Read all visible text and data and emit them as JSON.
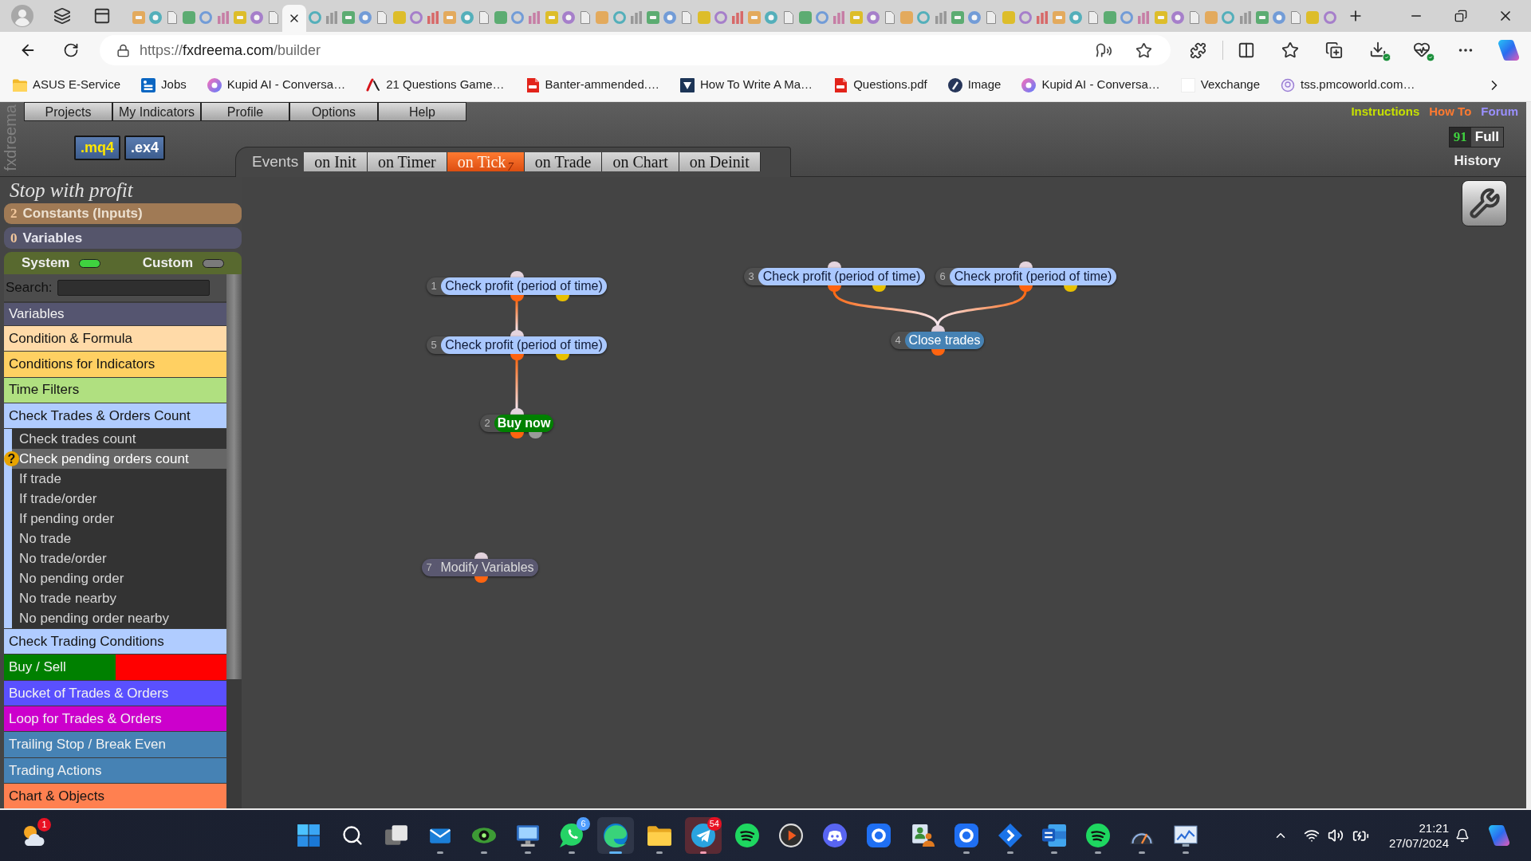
{
  "browser": {
    "tabs": [
      {
        "selected": false
      },
      {
        "selected": false
      },
      {
        "selected": false
      },
      {
        "selected": false
      },
      {
        "selected": false
      },
      {
        "selected": false
      },
      {
        "selected": false
      },
      {
        "selected": false
      },
      {
        "selected": false
      },
      {
        "selected": true
      },
      {
        "selected": false
      },
      {
        "selected": false
      },
      {
        "selected": false
      },
      {
        "selected": false
      },
      {
        "selected": false
      },
      {
        "selected": false
      },
      {
        "selected": false
      },
      {
        "selected": false
      },
      {
        "selected": false
      },
      {
        "selected": false
      },
      {
        "selected": false
      },
      {
        "selected": false
      },
      {
        "selected": false
      },
      {
        "selected": false
      },
      {
        "selected": false
      },
      {
        "selected": false
      },
      {
        "selected": false
      },
      {
        "selected": false
      },
      {
        "selected": false
      },
      {
        "selected": false
      },
      {
        "selected": false
      },
      {
        "selected": false
      },
      {
        "selected": false
      },
      {
        "selected": false
      },
      {
        "selected": false
      },
      {
        "selected": false
      },
      {
        "selected": false
      },
      {
        "selected": false
      },
      {
        "selected": false
      },
      {
        "selected": false
      },
      {
        "selected": false
      },
      {
        "selected": false
      },
      {
        "selected": false
      },
      {
        "selected": false
      },
      {
        "selected": false
      },
      {
        "selected": false
      },
      {
        "selected": false
      },
      {
        "selected": false
      },
      {
        "selected": false
      },
      {
        "selected": false
      },
      {
        "selected": false
      },
      {
        "selected": false
      },
      {
        "selected": false
      },
      {
        "selected": false
      },
      {
        "selected": false
      },
      {
        "selected": false
      },
      {
        "selected": false
      },
      {
        "selected": false
      },
      {
        "selected": false
      },
      {
        "selected": false
      },
      {
        "selected": false
      },
      {
        "selected": false
      },
      {
        "selected": false
      },
      {
        "selected": false
      },
      {
        "selected": false
      },
      {
        "selected": false
      },
      {
        "selected": false
      },
      {
        "selected": false
      },
      {
        "selected": false
      },
      {
        "selected": false
      },
      {
        "selected": false
      }
    ],
    "address": {
      "scheme": "https://",
      "domain": "fxdreema.com",
      "path": "/builder"
    },
    "bookmarks": [
      {
        "label": "ASUS E-Service",
        "kind": "folder"
      },
      {
        "label": "Jobs",
        "kind": "tile"
      },
      {
        "label": "Kupid AI - Conversa…",
        "kind": "disc"
      },
      {
        "label": "21 Questions Game…",
        "kind": "script"
      },
      {
        "label": "Banter-ammended.…",
        "kind": "pdf"
      },
      {
        "label": "How To Write A Ma…",
        "kind": "tile-dark"
      },
      {
        "label": "Questions.pdf",
        "kind": "pdf"
      },
      {
        "label": "Image",
        "kind": "disc-dark"
      },
      {
        "label": "Kupid AI - Conversa…",
        "kind": "disc"
      },
      {
        "label": "Vexchange",
        "kind": "blank"
      },
      {
        "label": "tss.pmcoworld.com…",
        "kind": "ring"
      }
    ]
  },
  "app": {
    "brand": "fxdreema",
    "menu": [
      "Projects",
      "My Indicators",
      "Profile",
      "Options",
      "Help"
    ],
    "file_buttons": [
      {
        "label": ".mq4",
        "color": "#ffe600"
      },
      {
        "label": ".ex4",
        "color": "#ffffff"
      }
    ],
    "events": {
      "label": "Events",
      "tabs": [
        {
          "label": "on Init",
          "selected": false
        },
        {
          "label": "on Timer",
          "selected": false
        },
        {
          "label": "on Tick",
          "count": "7",
          "selected": true
        },
        {
          "label": "on Trade",
          "selected": false
        },
        {
          "label": "on Chart",
          "selected": false
        },
        {
          "label": "on Deinit",
          "selected": false
        }
      ]
    },
    "links": [
      {
        "label": "Instructions",
        "color": "#c6e000"
      },
      {
        "label": "How To",
        "color": "#ff7a30"
      },
      {
        "label": "Forum",
        "color": "#9a90ff"
      }
    ],
    "counter": "91",
    "full_button": "Full",
    "history_link": "History",
    "sidebar": {
      "project_title": "Stop with profit",
      "constants": {
        "count": "2",
        "label": "Constants (Inputs)"
      },
      "variables": {
        "count": "0",
        "label": "Variables"
      },
      "toggles": [
        {
          "label": "System",
          "on": true
        },
        {
          "label": "Custom",
          "on": false
        }
      ],
      "search_label": "Search:",
      "categories": [
        {
          "label": "Variables",
          "color": "#555570"
        },
        {
          "label": "Condition & Formula",
          "color": "#ffdaa8"
        },
        {
          "label": "Conditions for Indicators",
          "color": "#ffd062"
        },
        {
          "label": "Time Filters",
          "color": "#b0e080"
        },
        {
          "label": "Check Trades & Orders Count",
          "color": "#b0ccff",
          "expanded": true,
          "children": [
            {
              "label": "Check trades count",
              "selected": false
            },
            {
              "label": "Check pending orders count",
              "selected": true,
              "help": "?"
            },
            {
              "label": "If trade",
              "selected": false
            },
            {
              "label": "If trade/order",
              "selected": false
            },
            {
              "label": "If pending order",
              "selected": false
            },
            {
              "label": "No trade",
              "selected": false
            },
            {
              "label": "No trade/order",
              "selected": false
            },
            {
              "label": "No pending order",
              "selected": false
            },
            {
              "label": "No trade nearby",
              "selected": false
            },
            {
              "label": "No pending order nearby",
              "selected": false
            }
          ]
        },
        {
          "label": "Check Trading Conditions",
          "color": "#b0ccff"
        },
        {
          "label": "Buy / Sell",
          "color": "#008000",
          "split": {
            "color": "#ff0000"
          }
        },
        {
          "label": "Bucket of Trades & Orders",
          "color": "#5a50ff"
        },
        {
          "label": "Loop for Trades & Orders",
          "color": "#cc00cc"
        },
        {
          "label": "Trailing Stop / Break Even",
          "color": "#4682b4"
        },
        {
          "label": "Trading Actions",
          "color": "#4682b4"
        },
        {
          "label": "Chart & Objects",
          "color": "#ff8050"
        }
      ]
    },
    "canvas": {
      "nodes": [
        {
          "number": "1",
          "label": "Check profit (period of time)",
          "kind": "condition",
          "color": "#aac8ff"
        },
        {
          "number": "3",
          "label": "Check profit (period of time)",
          "kind": "condition",
          "color": "#aac8ff"
        },
        {
          "number": "6",
          "label": "Check profit (period of time)",
          "kind": "condition",
          "color": "#aac8ff"
        },
        {
          "number": "4",
          "label": "Close trades",
          "kind": "close",
          "color": "#4682b4"
        },
        {
          "number": "5",
          "label": "Check profit (period of time)",
          "kind": "condition",
          "color": "#aac8ff"
        },
        {
          "number": "2",
          "label": "Buy now",
          "kind": "buy",
          "color": "#008000"
        },
        {
          "number": "7",
          "label": "Modify Variables",
          "kind": "variables",
          "color": "#5a5870"
        }
      ],
      "connections": [
        {
          "kind": "straight"
        },
        {
          "kind": "straight"
        },
        {
          "kind": "curve"
        },
        {
          "kind": "curve"
        }
      ]
    }
  },
  "taskbar": {
    "weather": {
      "badge": {
        "text": "1",
        "color": "#e81123"
      }
    },
    "apps": [
      {
        "kind": "start",
        "running": false,
        "active": false,
        "flashing": false
      },
      {
        "kind": "search",
        "running": false,
        "active": false,
        "flashing": false
      },
      {
        "kind": "taskview",
        "running": false,
        "active": false,
        "flashing": false
      },
      {
        "kind": "mail",
        "running": true,
        "active": false,
        "flashing": false
      },
      {
        "kind": "eye",
        "running": true,
        "active": false,
        "flashing": false
      },
      {
        "kind": "remote",
        "running": true,
        "active": false,
        "flashing": false
      },
      {
        "kind": "chat",
        "running": true,
        "active": false,
        "flashing": false,
        "badge": {
          "text": "6",
          "color": "#4f9dff"
        }
      },
      {
        "kind": "browser",
        "running": true,
        "active": true,
        "flashing": false
      },
      {
        "kind": "folder",
        "running": true,
        "active": false,
        "flashing": false
      },
      {
        "kind": "send",
        "running": true,
        "active": false,
        "flashing": true,
        "badge": {
          "text": "54",
          "color": "#e81123"
        }
      },
      {
        "kind": "music",
        "running": false,
        "active": false,
        "flashing": false
      },
      {
        "kind": "player",
        "running": false,
        "active": false,
        "flashing": false
      },
      {
        "kind": "controller",
        "running": false,
        "active": false,
        "flashing": false
      },
      {
        "kind": "tile",
        "running": false,
        "active": false,
        "flashing": false
      },
      {
        "kind": "people",
        "running": false,
        "active": false,
        "flashing": false
      },
      {
        "kind": "tile",
        "running": true,
        "active": false,
        "flashing": false
      },
      {
        "kind": "diamond",
        "running": true,
        "active": false,
        "flashing": false
      },
      {
        "kind": "doc",
        "running": true,
        "active": false,
        "flashing": false
      },
      {
        "kind": "music",
        "running": true,
        "active": false,
        "flashing": false
      },
      {
        "kind": "gauge",
        "running": true,
        "active": false,
        "flashing": false
      },
      {
        "kind": "chart",
        "running": true,
        "active": false,
        "flashing": false
      }
    ],
    "time": "21:21",
    "date": "27/07/2024"
  }
}
